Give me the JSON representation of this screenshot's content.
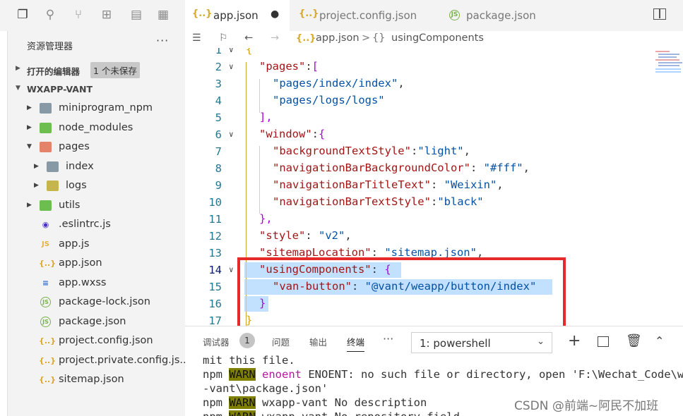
{
  "tabs": [
    {
      "label": "app.json",
      "icon": "{..}",
      "active": true,
      "modified": true
    },
    {
      "label": "project.config.json",
      "icon": "{..}",
      "active": false
    },
    {
      "label": "package.json",
      "icon": "JS",
      "active": false
    }
  ],
  "explorer": {
    "title": "资源管理器",
    "more": "···",
    "open_editors": "打开的编辑器",
    "unsaved_badge": "1 个未保存",
    "project": "WXAPP-VANT",
    "items": [
      {
        "name": "miniprogram_npm"
      },
      {
        "name": "node_modules"
      },
      {
        "name": "pages"
      },
      {
        "name": "index"
      },
      {
        "name": "logs"
      },
      {
        "name": "utils"
      },
      {
        "name": ".eslintrc.js"
      },
      {
        "name": "app.js"
      },
      {
        "name": "app.json"
      },
      {
        "name": "app.wxss"
      },
      {
        "name": "package-lock.json"
      },
      {
        "name": "package.json"
      },
      {
        "name": "project.config.json"
      },
      {
        "name": "project.private.config.js..."
      },
      {
        "name": "sitemap.json"
      }
    ]
  },
  "breadcrumb": {
    "file": "app.json",
    "sep": ">",
    "symbol": "usingComponents",
    "symbol_icon": "{}"
  },
  "editor": {
    "lines": [
      {
        "n": "1",
        "t": [
          "{"
        ]
      },
      {
        "n": "2",
        "t": [
          "\"pages\"",
          ":",
          "["
        ]
      },
      {
        "n": "3",
        "t": [
          "\"pages/index/index\"",
          ","
        ]
      },
      {
        "n": "4",
        "t": [
          "\"pages/logs/logs\""
        ]
      },
      {
        "n": "5",
        "t": [
          "],"
        ]
      },
      {
        "n": "6",
        "t": [
          "\"window\"",
          ":",
          "{"
        ]
      },
      {
        "n": "7",
        "t": [
          "\"backgroundTextStyle\"",
          ":",
          "\"light\"",
          ","
        ]
      },
      {
        "n": "8",
        "t": [
          "\"navigationBarBackgroundColor\"",
          ": ",
          "\"#fff\"",
          ","
        ]
      },
      {
        "n": "9",
        "t": [
          "\"navigationBarTitleText\"",
          ": ",
          "\"Weixin\"",
          ","
        ]
      },
      {
        "n": "10",
        "t": [
          "\"navigationBarTextStyle\"",
          ":",
          "\"black\""
        ]
      },
      {
        "n": "11",
        "t": [
          "},"
        ]
      },
      {
        "n": "12",
        "t": [
          "\"style\"",
          ": ",
          "\"v2\"",
          ","
        ]
      },
      {
        "n": "13",
        "t": [
          "\"sitemapLocation\"",
          ": ",
          "\"sitemap.json\"",
          ","
        ]
      },
      {
        "n": "14",
        "t": [
          "\"usingComponents\"",
          ": ",
          "{"
        ]
      },
      {
        "n": "15",
        "t": [
          "\"van-button\"",
          ": ",
          "\"@vant/weapp/button/index\""
        ]
      },
      {
        "n": "16",
        "t": [
          "}"
        ]
      },
      {
        "n": "17",
        "t": [
          "}"
        ]
      }
    ]
  },
  "panel": {
    "tabs": [
      "调试器",
      "问题",
      "输出",
      "终端"
    ],
    "debugger_badge": "1",
    "more": "···",
    "terminal_select": "1: powershell",
    "terminal_lines": {
      "l1": "mit this file.",
      "l2a": "npm ",
      "warn": "WARN",
      "l2b": " ",
      "enoent": "enoent",
      "l2c": " ENOENT: no such file or directory, open 'F:\\Wechat_Code\\wxap",
      "l3": "-vant\\package.json'",
      "l4b": " wxapp-vant No description",
      "l5b": " wxapp-vant No repository field."
    }
  },
  "watermark": "CSDN @前端~阿民不加班",
  "colors": {
    "accent_box": "#e62929",
    "selection": "#add6ff",
    "warn_bg": "#808000"
  }
}
